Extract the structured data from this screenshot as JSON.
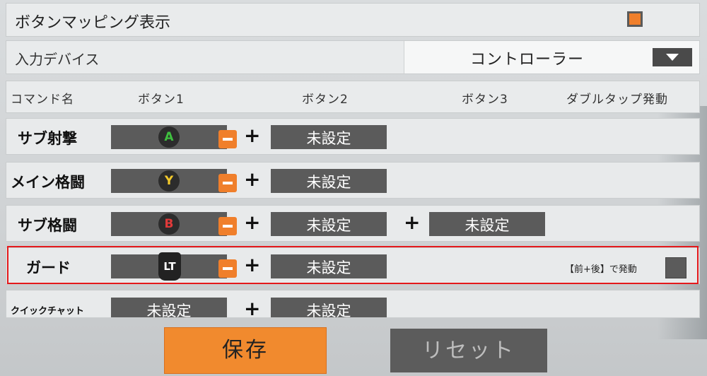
{
  "mapping_display": {
    "label": "ボタンマッピング表示",
    "checked": true
  },
  "input_device": {
    "label": "入力デバイス",
    "value": "コントローラー"
  },
  "columns": {
    "command": "コマンド名",
    "button1": "ボタン1",
    "button2": "ボタン2",
    "button3": "ボタン3",
    "double_tap": "ダブルタップ発動"
  },
  "plus": "+",
  "rows": [
    {
      "name": "サブ射撃",
      "button1_glyph": "A",
      "button1_color": "#3fbf3f",
      "button2": "未設定"
    },
    {
      "name": "メイン格闘",
      "button1_glyph": "Y",
      "button1_color": "#f2c92b",
      "button2": "未設定"
    },
    {
      "name": "サブ格闘",
      "button1_glyph": "B",
      "button1_color": "#e03a3a",
      "button2": "未設定",
      "button3": "未設定"
    },
    {
      "name": "ガード",
      "button1_glyph": "LT",
      "button2": "未設定",
      "front_back_label": "【前+後】で発動"
    },
    {
      "name": "クイックチャット",
      "button1": "未設定",
      "button2": "未設定"
    }
  ],
  "actions": {
    "save": "保存",
    "reset": "リセット"
  }
}
